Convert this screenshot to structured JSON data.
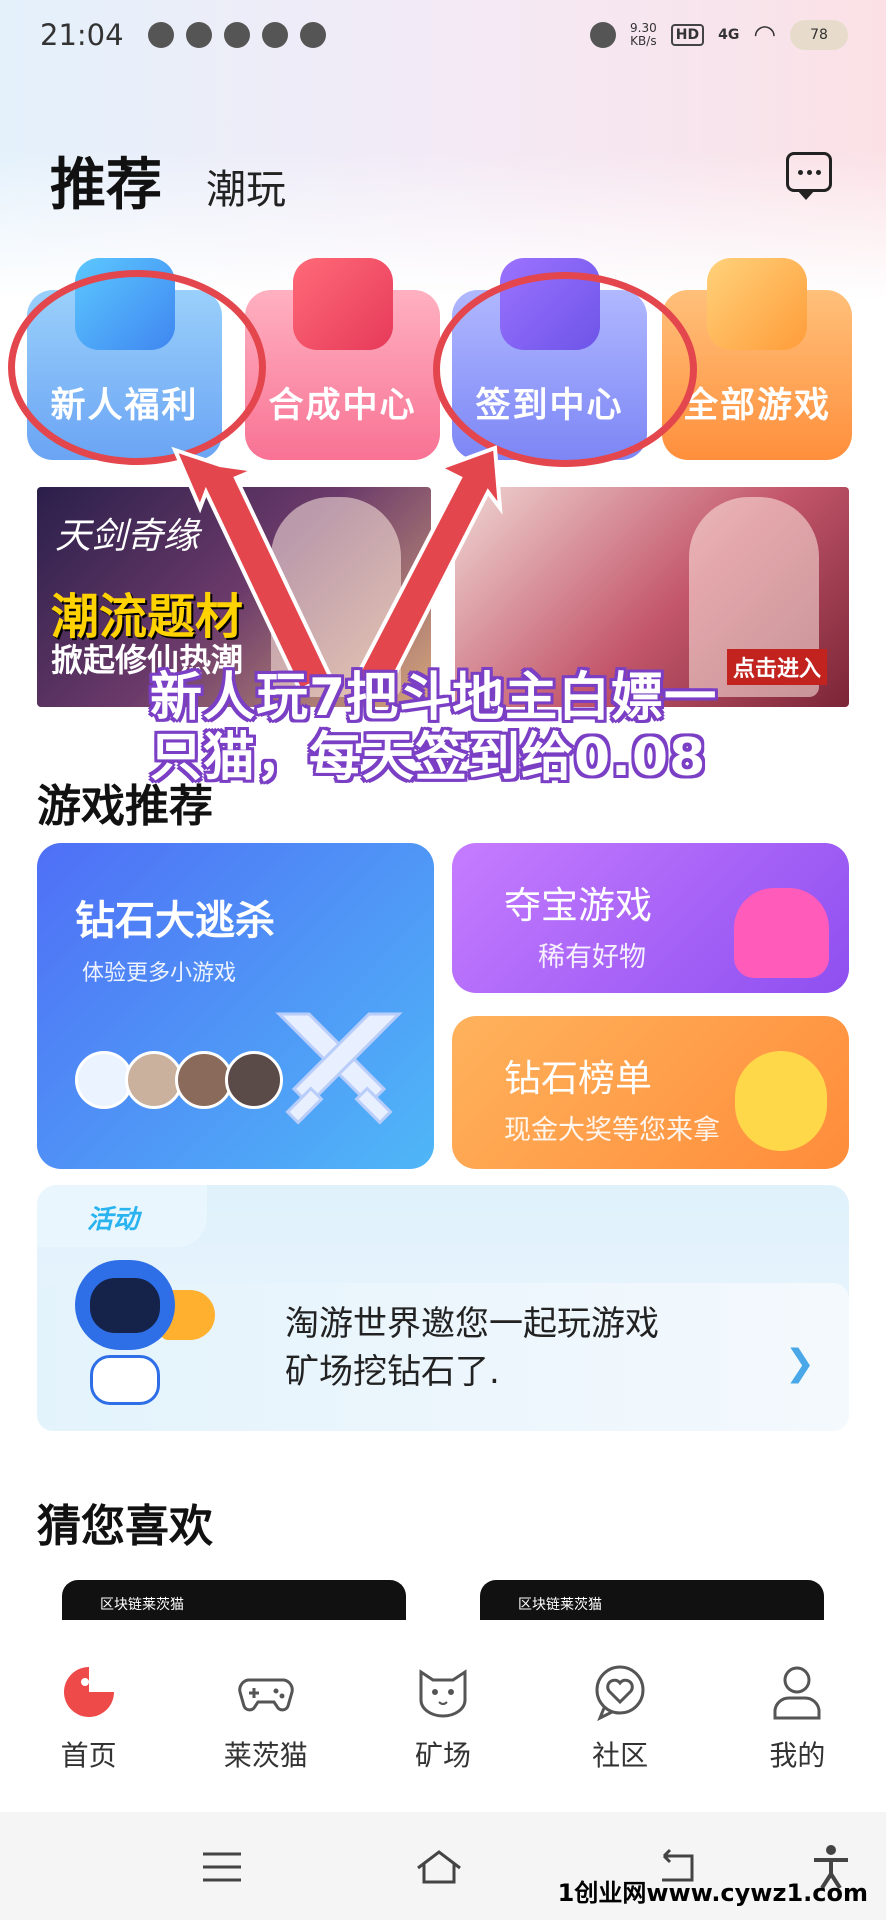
{
  "status_bar": {
    "time": "21:04",
    "net_speed": "9.30",
    "net_unit": "KB/s",
    "hd": "HD",
    "signal": "4G",
    "battery": "78"
  },
  "header": {
    "tabs": [
      {
        "label": "推荐",
        "active": true
      },
      {
        "label": "潮玩",
        "active": false
      }
    ]
  },
  "quick_entries": [
    {
      "label": "新人福利",
      "icon": "gamepad-icon"
    },
    {
      "label": "合成中心",
      "icon": "gift-bag-icon"
    },
    {
      "label": "签到中心",
      "icon": "gift-box-icon"
    },
    {
      "label": "全部游戏",
      "icon": "grid-icon"
    }
  ],
  "banners": [
    {
      "title_logo": "天剑奇缘",
      "headline": "潮流题材",
      "tagline": "掀起修仙热潮"
    },
    {
      "cta": "点击进入"
    }
  ],
  "overlay_text": "新人玩7把斗地主白嫖一只猫，每天签到给0.08",
  "game_section": {
    "title": "游戏推荐",
    "big_card": {
      "title": "钻石大逃杀",
      "subtitle": "体验更多小游戏"
    },
    "small_cards": [
      {
        "title": "夺宝游戏",
        "subtitle": "稀有好物"
      },
      {
        "title": "钻石榜单",
        "subtitle": "现金大奖等您来拿"
      }
    ]
  },
  "activity": {
    "tag": "活动",
    "text_line1": "淘游世界邀您一起玩游戏",
    "text_line2": "矿场挖钻石了."
  },
  "guess_section": {
    "title": "猜您喜欢",
    "items": [
      {
        "label": "区块链莱茨猫"
      },
      {
        "label": "区块链莱茨猫"
      }
    ]
  },
  "bottom_nav": [
    {
      "label": "首页",
      "icon": "home-pacman-icon",
      "active": true
    },
    {
      "label": "莱茨猫",
      "icon": "gamepad-icon",
      "active": false
    },
    {
      "label": "矿场",
      "icon": "cat-icon",
      "active": false
    },
    {
      "label": "社区",
      "icon": "heart-chat-icon",
      "active": false
    },
    {
      "label": "我的",
      "icon": "person-icon",
      "active": false
    }
  ],
  "watermark": "1创业网www.cywz1.com",
  "colors": {
    "accent_red": "#e4464d",
    "overlay_purple": "#7a3fc4",
    "nav_active": "#ee4a4a"
  }
}
